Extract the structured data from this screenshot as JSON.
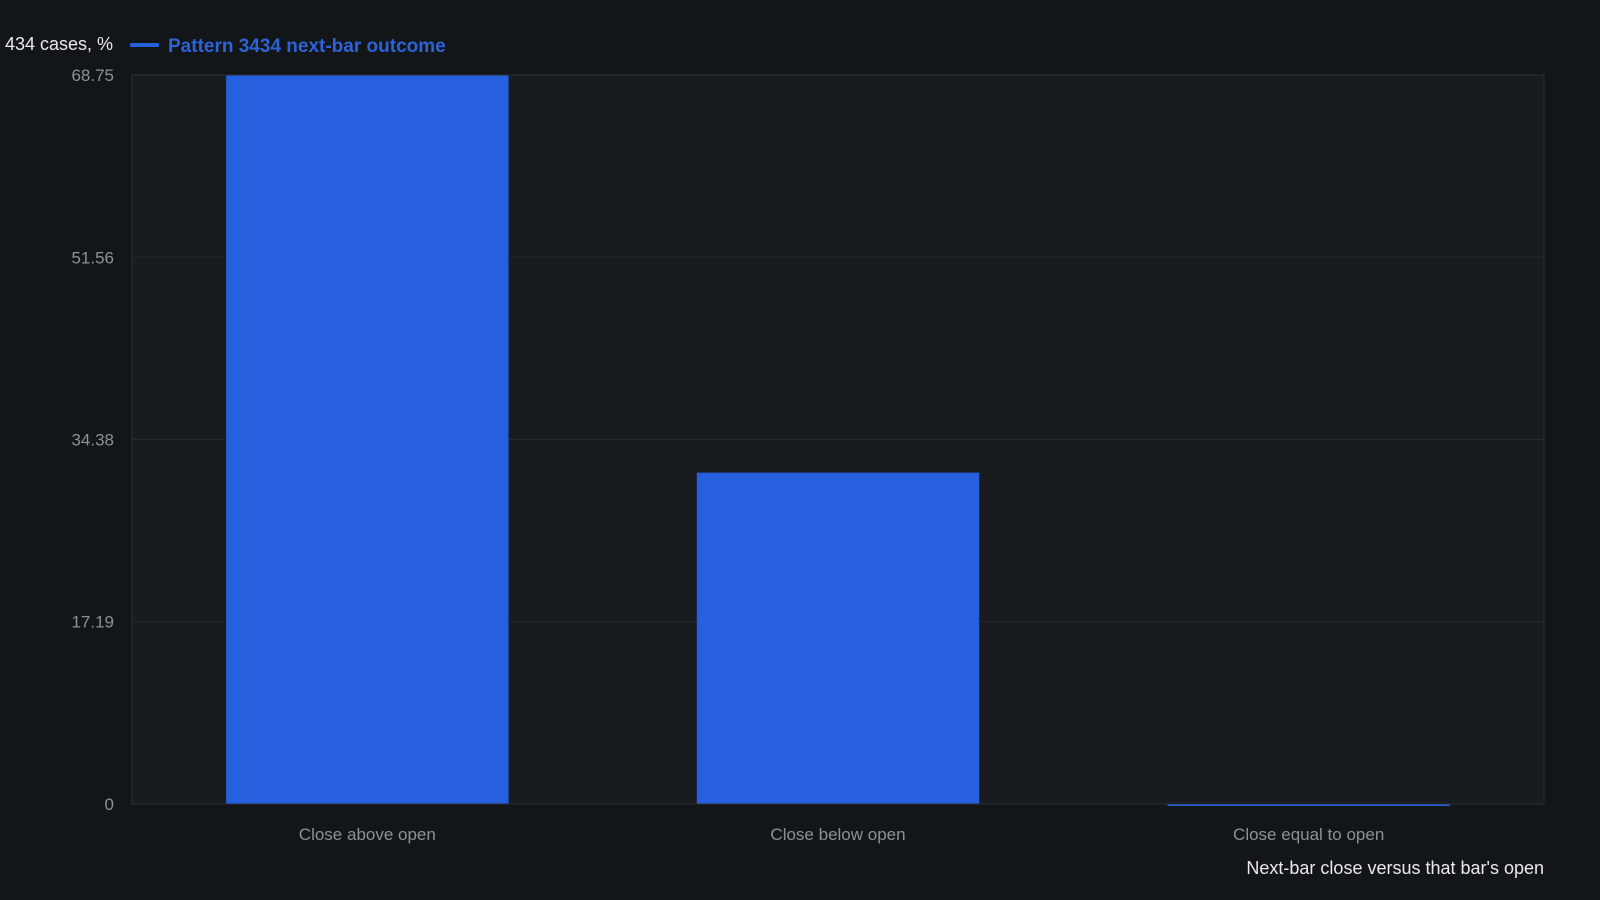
{
  "colors": {
    "page_background": "#131619",
    "plot_background": "#181b1f",
    "plot_border": "#2b2f36",
    "grid": "#262a30",
    "bar": "#2660de",
    "legend_text": "#2d62d8",
    "tick_text": "#8c9098",
    "title_text": "#e8eaed"
  },
  "chart_data": {
    "type": "bar",
    "ylabel": "434 cases, %",
    "xlabel": "Next-bar close versus that bar's open",
    "legend": {
      "position": "top-left",
      "entries": [
        "Pattern 3434 next-bar outcome"
      ]
    },
    "categories": [
      "Close above open",
      "Close below open",
      "Close equal to open"
    ],
    "series": [
      {
        "name": "Pattern 3434 next-bar outcome",
        "values": [
          68.75,
          31.25,
          0
        ]
      }
    ],
    "ylim": [
      0,
      68.75
    ],
    "yticks": [
      "68.75",
      "51.56",
      "34.38",
      "17.19",
      "0"
    ],
    "ytick_values": [
      68.75,
      51.56,
      34.38,
      17.19,
      0
    ],
    "grid": true
  }
}
